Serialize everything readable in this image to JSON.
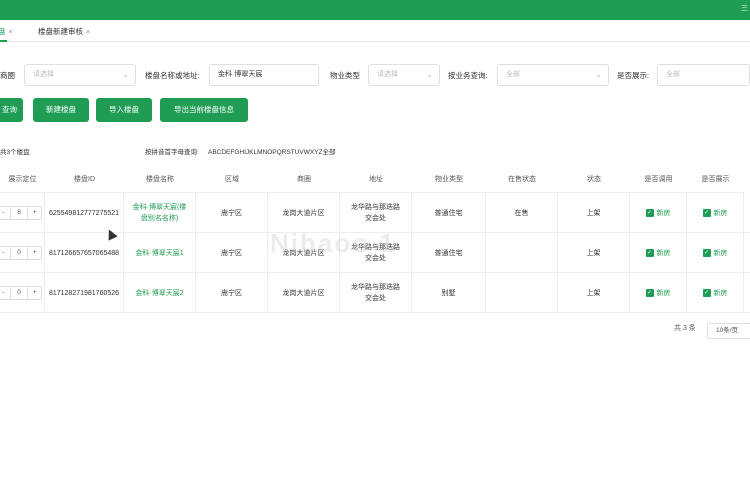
{
  "topbar": {
    "corner_text": "三"
  },
  "tabs": [
    {
      "label": "盘",
      "close": "×"
    },
    {
      "label": "楼盘新建审核",
      "close": "×"
    }
  ],
  "filters": {
    "business_area": {
      "label": "商圈",
      "placeholder": "请选择"
    },
    "name_or_address": {
      "label": "楼盘名称或地址:",
      "value": "金科·博翠天宸"
    },
    "property_type": {
      "label": "物业类型",
      "placeholder": "请选择"
    },
    "business_query": {
      "label": "按业务查询:",
      "placeholder": "全部"
    },
    "display": {
      "label": "是否展示:",
      "placeholder": "全部"
    }
  },
  "buttons": {
    "query": "查询",
    "new": "新建楼盘",
    "import": "导入楼盘",
    "export": "导出当前楼盘信息"
  },
  "info": {
    "count_text": "共3个楼盘",
    "pinyin_label": "按拼音首字母查询:",
    "pinyin_letters": "ABCDEFGHIJKLMNOPQRSTUVWXYZ全部"
  },
  "table": {
    "headers": [
      "展示定位",
      "楼盘ID",
      "楼盘名称",
      "区域",
      "商圈",
      "地址",
      "物业类型",
      "在售状态",
      "状态",
      "是否调用",
      "是否展示"
    ],
    "rows": [
      {
        "position": "8",
        "id": "625549812777275521",
        "name": "金科·博翠天宸(楼盘别名名称)",
        "district": "嵩宁区",
        "area": "龙岗大道片区",
        "address": "龙华路与那迭路交会处",
        "type": "普通住宅",
        "sale": "在售",
        "status": "上架",
        "called": "新房",
        "shown": "新房"
      },
      {
        "position": "0",
        "id": "817126657657065488",
        "name": "金科·博翠天宸1",
        "district": "嵩宁区",
        "area": "龙岗大道片区",
        "address": "龙华路与那迭路交会处",
        "type": "普通住宅",
        "sale": "",
        "status": "上架",
        "called": "新房",
        "shown": "新房"
      },
      {
        "position": "0",
        "id": "817128271981760526",
        "name": "金科·博翠天宸2",
        "district": "嵩宁区",
        "area": "龙岗大道片区",
        "address": "龙华路与那迭路交会处",
        "type": "别墅",
        "sale": "",
        "status": "上架",
        "called": "新房",
        "shown": "新房"
      }
    ]
  },
  "pagination": {
    "total": "共 3 条",
    "page_size": "10条/页"
  },
  "stepper": {
    "minus": "-",
    "plus": "+"
  },
  "check_mark": "✓",
  "watermark": "Nihaoo 1"
}
